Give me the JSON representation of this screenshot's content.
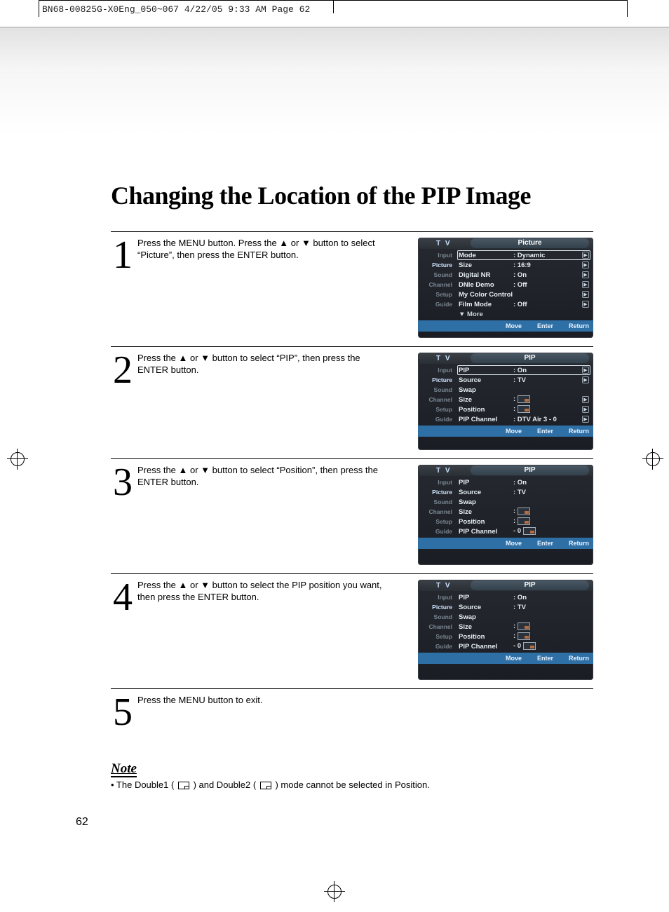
{
  "print_header": "BN68-00825G-X0Eng_050~067  4/22/05  9:33 AM  Page 62",
  "title": "Changing the Location of the PIP Image",
  "steps": [
    {
      "num": "1",
      "text": "Press the MENU button. Press the ▲ or ▼ button to select “Picture”, then press the ENTER button."
    },
    {
      "num": "2",
      "text": "Press the ▲ or ▼ button to select “PIP”, then press the ENTER button."
    },
    {
      "num": "3",
      "text": "Press the ▲ or ▼ button to select “Position”, then press the ENTER button."
    },
    {
      "num": "4",
      "text": "Press the ▲ or ▼ button to select the PIP position you want, then press the ENTER button."
    },
    {
      "num": "5",
      "text": "Press the MENU button to exit."
    }
  ],
  "osd_common": {
    "tv_label": "T V",
    "sidebar": [
      "Input",
      "Picture",
      "Sound",
      "Channel",
      "Setup",
      "Guide"
    ],
    "footer": {
      "move": "Move",
      "enter": "Enter",
      "return": "Return"
    }
  },
  "osd1": {
    "title": "Picture",
    "active_sidebar_index": 1,
    "rows": [
      {
        "label": "Mode",
        "value": ": Dynamic",
        "highlight": true,
        "arrow": true
      },
      {
        "label": "Size",
        "value": ": 16:9",
        "arrow": true
      },
      {
        "label": "Digital NR",
        "value": ": On",
        "arrow": true
      },
      {
        "label": "DNIe Demo",
        "value": ": Off",
        "arrow": true
      },
      {
        "label": "My Color Control",
        "value": "",
        "arrow": true
      },
      {
        "label": "Film Mode",
        "value": ": Off",
        "arrow": true
      },
      {
        "label": "▼ More",
        "value": "",
        "arrow": false,
        "more": true
      }
    ]
  },
  "osd2": {
    "title": "PIP",
    "active_sidebar_index": 1,
    "rows": [
      {
        "label": "PIP",
        "value": ": On",
        "highlight": true,
        "arrow": true
      },
      {
        "label": "Source",
        "value": ": TV",
        "arrow": true
      },
      {
        "label": "Swap",
        "value": "",
        "arrow": false
      },
      {
        "label": "Size",
        "value": ":",
        "arrow": true,
        "icon": true
      },
      {
        "label": "Position",
        "value": ":",
        "arrow": true,
        "icon": true
      },
      {
        "label": "PIP Channel",
        "value": ": DTV Air 3 - 0",
        "arrow": true
      }
    ]
  },
  "osd3": {
    "title": "PIP",
    "active_sidebar_index": 1,
    "dimmed": true,
    "rows": [
      {
        "label": "PIP",
        "value": ": On"
      },
      {
        "label": "Source",
        "value": ": TV"
      },
      {
        "label": "Swap",
        "value": ""
      },
      {
        "label": "Size",
        "value": ":",
        "icon": true
      },
      {
        "label": "Position",
        "value": ":",
        "graphic": true
      },
      {
        "label": "PIP Channel",
        "value": "         - 0",
        "graphic": true
      }
    ]
  },
  "osd4": {
    "title": "PIP",
    "active_sidebar_index": 1,
    "dimmed": true,
    "rows": [
      {
        "label": "PIP",
        "value": ": On"
      },
      {
        "label": "Source",
        "value": ": TV"
      },
      {
        "label": "Swap",
        "value": ""
      },
      {
        "label": "Size",
        "value": ":",
        "icon": true
      },
      {
        "label": "Position",
        "value": ":",
        "graphic": true
      },
      {
        "label": "PIP Channel",
        "value": "         - 0",
        "graphic": true
      }
    ]
  },
  "note": {
    "label": "Note",
    "text_pre": "•  The Double1 (",
    "text_mid": ") and Double2 (",
    "text_post": ") mode cannot be selected in Position."
  },
  "page_num": "62"
}
